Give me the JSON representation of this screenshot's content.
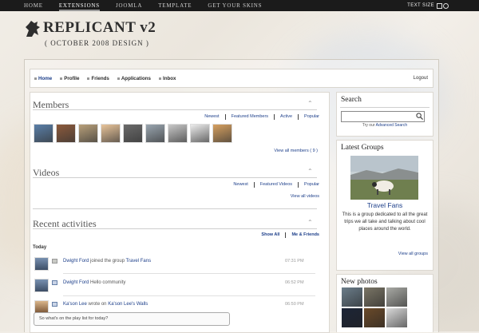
{
  "topnav": {
    "items": [
      "HOME",
      "EXTENSIONS",
      "JOOMLA",
      "TEMPLATE",
      "GET YOUR SKINS"
    ],
    "active_index": 1,
    "text_size_label": "TEXT SIZE"
  },
  "logo": {
    "brand": "REPLICANT v2",
    "tagline": "( OCTOBER 2008 DESIGN )"
  },
  "menu": {
    "items": [
      "Home",
      "Profile",
      "Friends",
      "Applications",
      "Inbox"
    ],
    "logout": "Logout"
  },
  "members": {
    "title": "Members",
    "tabs": [
      "Newest",
      "Featured Members",
      "Active",
      "Popular"
    ],
    "view_all": "View all members ( 9 )",
    "avatar_colors": [
      "#5a7fa8",
      "#8c5a3c",
      "#b8a07a",
      "#e8c49a",
      "#6a6a6a",
      "#9aa6b0",
      "#c8c8c8",
      "#ececec",
      "#d6a060"
    ]
  },
  "videos": {
    "title": "Videos",
    "tabs": [
      "Newest",
      "Featured Videos",
      "Popular"
    ],
    "view_all": "View all videos"
  },
  "activities": {
    "title": "Recent activities",
    "filters": [
      "Show All",
      "Me & Friends"
    ],
    "day_label": "Today",
    "rows": [
      {
        "actor": "Dwight Ford",
        "text": " joined the group ",
        "target": "Travel Fans",
        "time": "07:31 PM"
      },
      {
        "actor": "Dwight Ford",
        "text": " Hello community",
        "target": "",
        "time": "06:52 PM"
      },
      {
        "actor": "Ka'son Lee",
        "text": " wrote on ",
        "target": "Ka'son Lee's Walls",
        "time": "06:50 PM"
      }
    ],
    "comment": "So what's on the play list for today?"
  },
  "search": {
    "title": "Search",
    "placeholder": "",
    "advanced_prefix": "Try our ",
    "advanced_link": "Advanced Search"
  },
  "latest_groups": {
    "title": "Latest Groups",
    "group_name": "Travel Fans",
    "description": "This is a group dedicated to all the great trips we all take and talking about cool places around the world.",
    "view_all": "View all groups"
  },
  "new_photos": {
    "title": "New photos",
    "photo_colors": [
      "#6b7d8a",
      "#7a7566",
      "#a9aaa5",
      "#1c2436",
      "#6a4a2a",
      "#d9d9d9"
    ]
  },
  "colors": {
    "link": "#1d3f8a",
    "topbar": "#1b1b1b"
  }
}
